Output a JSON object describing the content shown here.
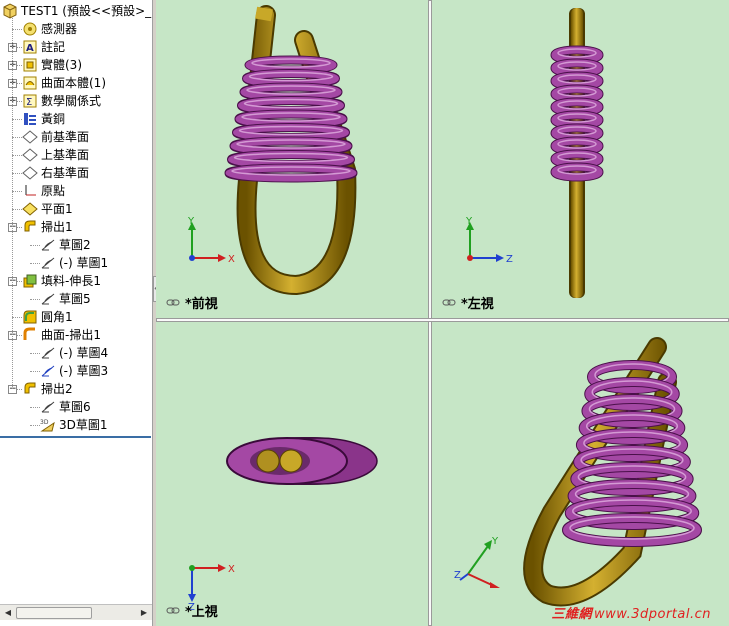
{
  "tree": {
    "root": "TEST1 (預設<<預設>_",
    "items": [
      {
        "label": "感測器",
        "icon": "sensor-icon",
        "depth": 1,
        "expander": ""
      },
      {
        "label": "註記",
        "icon": "annotation-icon",
        "depth": 1,
        "expander": "+"
      },
      {
        "label": "實體(3)",
        "icon": "solid-bodies-icon",
        "depth": 1,
        "expander": "+"
      },
      {
        "label": "曲面本體(1)",
        "icon": "surface-bodies-icon",
        "depth": 1,
        "expander": "+"
      },
      {
        "label": "數學關係式",
        "icon": "equations-icon",
        "depth": 1,
        "expander": "+"
      },
      {
        "label": "黃銅",
        "icon": "material-icon",
        "depth": 1,
        "expander": ""
      },
      {
        "label": "前基準面",
        "icon": "plane-icon",
        "depth": 1,
        "expander": ""
      },
      {
        "label": "上基準面",
        "icon": "plane-icon",
        "depth": 1,
        "expander": ""
      },
      {
        "label": "右基準面",
        "icon": "plane-icon",
        "depth": 1,
        "expander": ""
      },
      {
        "label": "原點",
        "icon": "origin-icon",
        "depth": 1,
        "expander": ""
      },
      {
        "label": "平面1",
        "icon": "plane-yellow-icon",
        "depth": 1,
        "expander": ""
      },
      {
        "label": "掃出1",
        "icon": "sweep-icon",
        "depth": 1,
        "expander": "−"
      },
      {
        "label": "草圖2",
        "icon": "sketch-icon",
        "depth": 2,
        "expander": ""
      },
      {
        "label": "(-) 草圖1",
        "icon": "sketch-icon",
        "depth": 2,
        "expander": ""
      },
      {
        "label": "填料-伸長1",
        "icon": "extrude-icon",
        "depth": 1,
        "expander": "−"
      },
      {
        "label": "草圖5",
        "icon": "sketch-icon",
        "depth": 2,
        "expander": ""
      },
      {
        "label": "圓角1",
        "icon": "fillet-icon",
        "depth": 1,
        "expander": ""
      },
      {
        "label": "曲面-掃出1",
        "icon": "surface-sweep-icon",
        "depth": 1,
        "expander": "−"
      },
      {
        "label": "(-) 草圖4",
        "icon": "sketch-icon",
        "depth": 2,
        "expander": ""
      },
      {
        "label": "(-) 草圖3",
        "icon": "sketch-blue-icon",
        "depth": 2,
        "expander": ""
      },
      {
        "label": "掃出2",
        "icon": "sweep-icon",
        "depth": 1,
        "expander": "−"
      },
      {
        "label": "草圖6",
        "icon": "sketch-icon",
        "depth": 2,
        "expander": ""
      },
      {
        "label": "3D草圖1",
        "icon": "sketch-3d-icon",
        "depth": 2,
        "expander": ""
      }
    ]
  },
  "viewports": {
    "front": {
      "label": "*前視"
    },
    "left": {
      "label": "*左視"
    },
    "top": {
      "label": "*上視"
    },
    "iso": {
      "label": ""
    }
  },
  "axes": {
    "x": "X",
    "y": "Y",
    "z": "Z"
  },
  "watermark": {
    "cn": "三維網",
    "url": "www.3dportal.cn"
  },
  "colors": {
    "viewport_bg": "#c6e6c6",
    "coil_purple": "#9a3f9a",
    "rod_gold": "#b08a10",
    "axis_x": "#d02020",
    "axis_y": "#20a020",
    "axis_z": "#2040d0"
  }
}
